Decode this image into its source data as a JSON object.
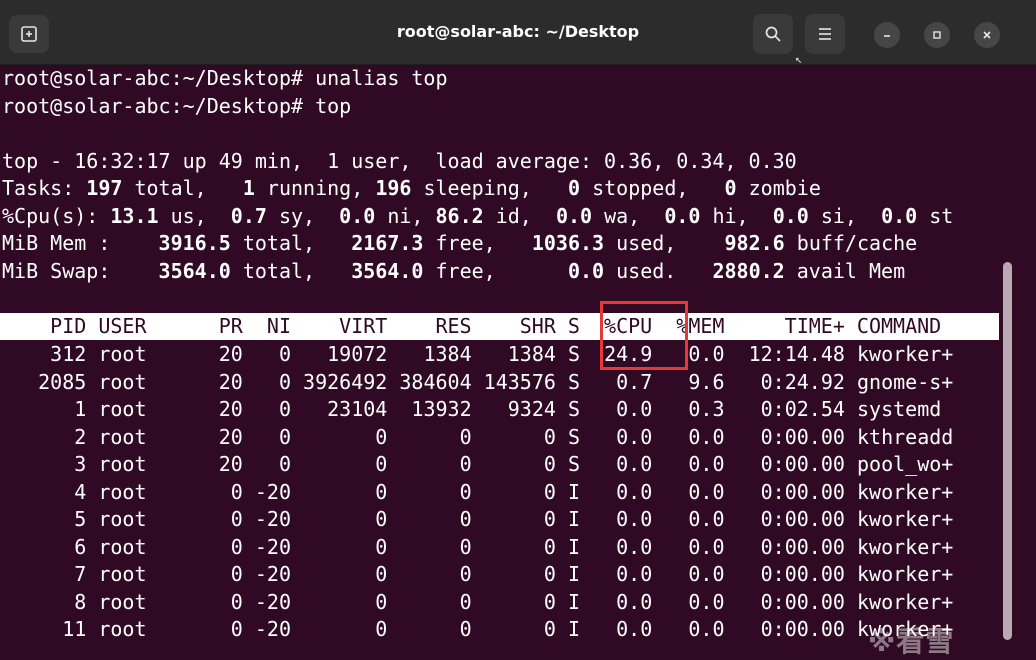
{
  "window": {
    "title": "root@solar-abc: ~/Desktop",
    "icons": {
      "new_tab": "new-tab-icon",
      "search": "search-icon",
      "menu": "hamburger-menu-icon",
      "minimize": "minimize-icon",
      "maximize": "maximize-icon",
      "close": "close-icon"
    }
  },
  "terminal": {
    "commands": [
      "root@solar-abc:~/Desktop# unalias top",
      "root@solar-abc:~/Desktop# top"
    ],
    "summary": {
      "uptime_line": "top - 16:32:17 up 49 min,  1 user,  load average: 0.36, 0.34, 0.30",
      "tasks": {
        "label": "Tasks:",
        "total": "197",
        "running": "1",
        "sleeping": "196",
        "stopped": "0",
        "zombie": "0"
      },
      "cpu": {
        "label": "%Cpu(s):",
        "us": "13.1",
        "sy": "0.7",
        "ni": "0.0",
        "id": "86.2",
        "wa": "0.0",
        "hi": "0.0",
        "si": "0.0",
        "st": "0.0"
      },
      "mem": {
        "label": "MiB Mem :",
        "total": "3916.5",
        "free": "2167.3",
        "used": "1036.3",
        "buff_cache": "982.6"
      },
      "swap": {
        "label": "MiB Swap:",
        "total": "3564.0",
        "free": "3564.0",
        "used": "0.0",
        "avail": "2880.2"
      }
    },
    "table_header": "    PID USER      PR  NI    VIRT    RES    SHR S  %CPU  %MEM     TIME+ COMMAND",
    "processes": [
      {
        "pid": "312",
        "user": "root",
        "pr": "20",
        "ni": "0",
        "virt": "19072",
        "res": "1384",
        "shr": "1384",
        "s": "S",
        "cpu": "24.9",
        "mem": "0.0",
        "time": "12:14.48",
        "cmd": "kworker+"
      },
      {
        "pid": "2085",
        "user": "root",
        "pr": "20",
        "ni": "0",
        "virt": "3926492",
        "res": "384604",
        "shr": "143576",
        "s": "S",
        "cpu": "0.7",
        "mem": "9.6",
        "time": "0:24.92",
        "cmd": "gnome-s+"
      },
      {
        "pid": "1",
        "user": "root",
        "pr": "20",
        "ni": "0",
        "virt": "23104",
        "res": "13932",
        "shr": "9324",
        "s": "S",
        "cpu": "0.0",
        "mem": "0.3",
        "time": "0:02.54",
        "cmd": "systemd"
      },
      {
        "pid": "2",
        "user": "root",
        "pr": "20",
        "ni": "0",
        "virt": "0",
        "res": "0",
        "shr": "0",
        "s": "S",
        "cpu": "0.0",
        "mem": "0.0",
        "time": "0:00.00",
        "cmd": "kthreadd"
      },
      {
        "pid": "3",
        "user": "root",
        "pr": "20",
        "ni": "0",
        "virt": "0",
        "res": "0",
        "shr": "0",
        "s": "S",
        "cpu": "0.0",
        "mem": "0.0",
        "time": "0:00.00",
        "cmd": "pool_wo+"
      },
      {
        "pid": "4",
        "user": "root",
        "pr": "0",
        "ni": "-20",
        "virt": "0",
        "res": "0",
        "shr": "0",
        "s": "I",
        "cpu": "0.0",
        "mem": "0.0",
        "time": "0:00.00",
        "cmd": "kworker+"
      },
      {
        "pid": "5",
        "user": "root",
        "pr": "0",
        "ni": "-20",
        "virt": "0",
        "res": "0",
        "shr": "0",
        "s": "I",
        "cpu": "0.0",
        "mem": "0.0",
        "time": "0:00.00",
        "cmd": "kworker+"
      },
      {
        "pid": "6",
        "user": "root",
        "pr": "0",
        "ni": "-20",
        "virt": "0",
        "res": "0",
        "shr": "0",
        "s": "I",
        "cpu": "0.0",
        "mem": "0.0",
        "time": "0:00.00",
        "cmd": "kworker+"
      },
      {
        "pid": "7",
        "user": "root",
        "pr": "0",
        "ni": "-20",
        "virt": "0",
        "res": "0",
        "shr": "0",
        "s": "I",
        "cpu": "0.0",
        "mem": "0.0",
        "time": "0:00.00",
        "cmd": "kworker+"
      },
      {
        "pid": "8",
        "user": "root",
        "pr": "0",
        "ni": "-20",
        "virt": "0",
        "res": "0",
        "shr": "0",
        "s": "I",
        "cpu": "0.0",
        "mem": "0.0",
        "time": "0:00.00",
        "cmd": "kworker+"
      },
      {
        "pid": "11",
        "user": "root",
        "pr": "0",
        "ni": "-20",
        "virt": "0",
        "res": "0",
        "shr": "0",
        "s": "I",
        "cpu": "0.0",
        "mem": "0.0",
        "time": "0:00.00",
        "cmd": "kworker+"
      }
    ],
    "highlight_color": "#e53935",
    "background_color": "#300a24"
  },
  "watermark": "※看雪"
}
